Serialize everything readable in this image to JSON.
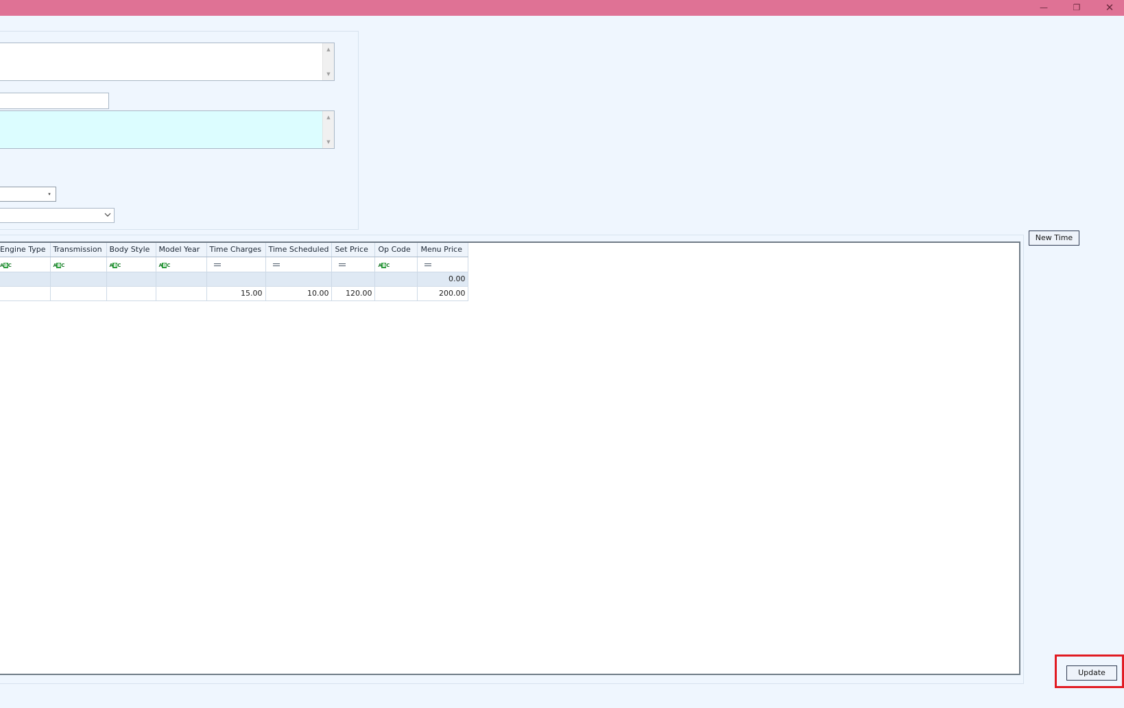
{
  "window": {
    "minimize_glyph": "—",
    "restore_glyph": "❐",
    "close_glyph": "✕"
  },
  "form": {
    "combo_arrow": "▾"
  },
  "grid": {
    "columns": [
      {
        "label": "Engine Type",
        "filter": "text"
      },
      {
        "label": "Transmission",
        "filter": "text"
      },
      {
        "label": "Body Style",
        "filter": "text"
      },
      {
        "label": "Model Year",
        "filter": "text"
      },
      {
        "label": "Time Charges",
        "filter": "equals"
      },
      {
        "label": "Time Scheduled",
        "filter": "equals"
      },
      {
        "label": "Set Price",
        "filter": "equals"
      },
      {
        "label": "Op Code",
        "filter": "text"
      },
      {
        "label": "Menu Price",
        "filter": "equals"
      }
    ],
    "filter_text_icon": {
      "a": "A",
      "b": "B",
      "c": "C"
    },
    "rows": [
      [
        "",
        "",
        "",
        "",
        "",
        "",
        "",
        "",
        "0.00"
      ],
      [
        "",
        "",
        "",
        "",
        "15.00",
        "10.00",
        "120.00",
        "",
        "200.00"
      ]
    ]
  },
  "buttons": {
    "new_time": "New Time",
    "update": "Update"
  },
  "colors": {
    "titlebar": "#df7295",
    "background": "#eff6fe",
    "highlight": "#e11b22",
    "memo_cyan": "#dcfdff"
  }
}
